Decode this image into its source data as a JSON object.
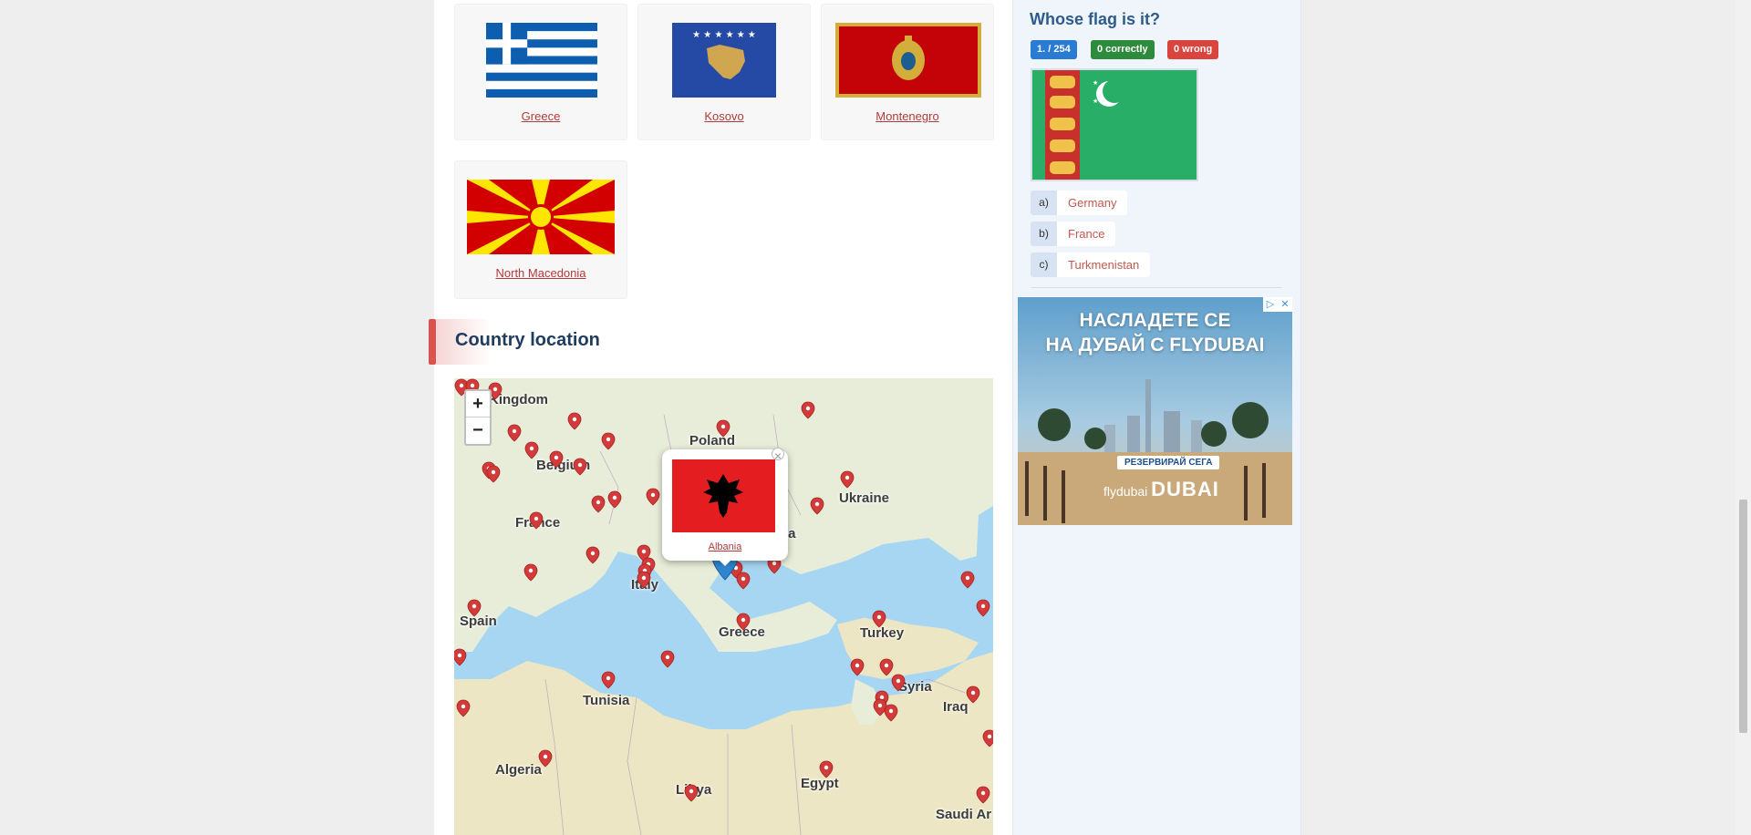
{
  "neighbors": [
    {
      "name": "Greece"
    },
    {
      "name": "Kosovo"
    },
    {
      "name": "Montenegro"
    },
    {
      "name": "North Macedonia"
    }
  ],
  "section": {
    "title": "Country location"
  },
  "map": {
    "zoom_in": "+",
    "zoom_out": "−",
    "labels": [
      "Kingdom",
      "Poland",
      "Belgium",
      "Ukraine",
      "France",
      "Italy",
      "Spain",
      "Greece",
      "Turkey",
      "Tunisia",
      "Syria",
      "Iraq",
      "Algeria",
      "Libya",
      "Egypt",
      "Saudi Ar",
      "ia"
    ],
    "popup": {
      "country": "Albania",
      "close": "×"
    }
  },
  "quiz": {
    "title": "Whose flag is it?",
    "progress": "1. / 254",
    "correct": "0 correctly",
    "wrong": "0 wrong",
    "answers": [
      {
        "letter": "a)",
        "label": "Germany"
      },
      {
        "letter": "b)",
        "label": "France"
      },
      {
        "letter": "c)",
        "label": "Turkmenistan"
      }
    ]
  },
  "ad": {
    "headline_1": "НАСЛАДЕТЕ СЕ",
    "headline_2": "НА ДУБАЙ С FLYDUBAI",
    "cta": "РЕЗЕРВИРАЙ СЕГА",
    "brand_1": "flydubai",
    "brand_2": "DUBAI",
    "info_icon": "▷",
    "close_icon": "✕"
  },
  "colors": {
    "link": "#b33a3a",
    "heading": "#1f3b5e",
    "accent": "#d9534f",
    "badge_blue": "#2a7bd3",
    "badge_green": "#2e8b3e",
    "badge_red": "#d9443c"
  }
}
